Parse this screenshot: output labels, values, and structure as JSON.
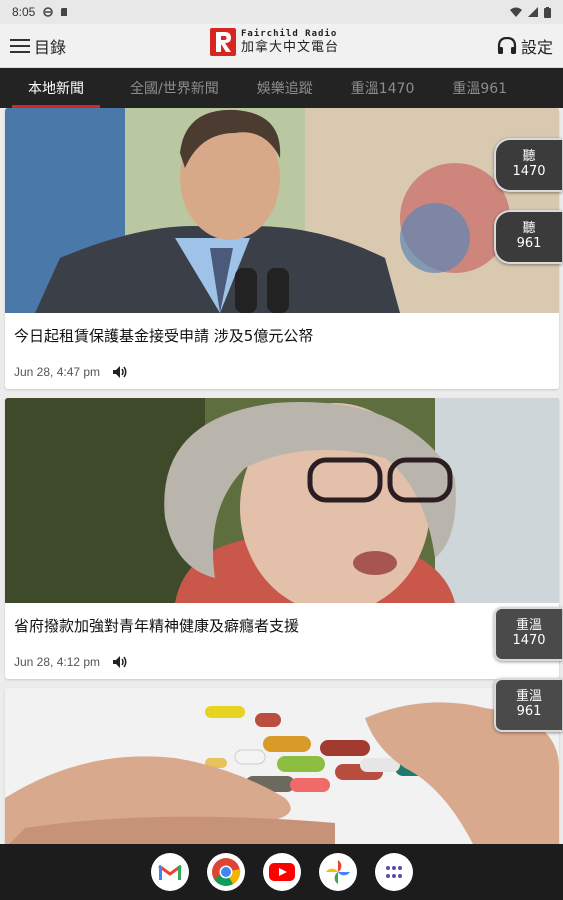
{
  "status_bar": {
    "time": "8:05"
  },
  "app_bar": {
    "menu_label": "目錄",
    "logo_en": "Fairchild Radio",
    "logo_zh": "加拿大中文電台",
    "settings_label": "設定"
  },
  "tabs": [
    {
      "label": "本地新聞",
      "active": true
    },
    {
      "label": "全國/世界新聞",
      "active": false
    },
    {
      "label": "娛樂追蹤",
      "active": false
    },
    {
      "label": "重溫1470",
      "active": false
    },
    {
      "label": "重溫961",
      "active": false
    }
  ],
  "articles": [
    {
      "title": "今日起租賃保護基金接受申請  涉及5億元公帑",
      "date": "Jun 28, 4:47 pm"
    },
    {
      "title": "省府撥款加強對青年精神健康及癖癮者支援",
      "date": "Jun 28, 4:12 pm"
    },
    {
      "title": "",
      "date": ""
    }
  ],
  "floating_buttons": {
    "listen_1470": {
      "line1": "聽",
      "line2": "1470"
    },
    "listen_961": {
      "line1": "聽",
      "line2": "961"
    },
    "replay_1470": {
      "line1": "重溫",
      "line2": "1470"
    },
    "replay_961": {
      "line1": "重溫",
      "line2": "961"
    }
  },
  "dock": [
    "gmail-icon",
    "chrome-icon",
    "youtube-icon",
    "photos-icon",
    "app-drawer-icon"
  ],
  "colors": {
    "accent": "#d7261e",
    "tab_bg": "#232323",
    "fab_bg": "#3b3b3b"
  }
}
